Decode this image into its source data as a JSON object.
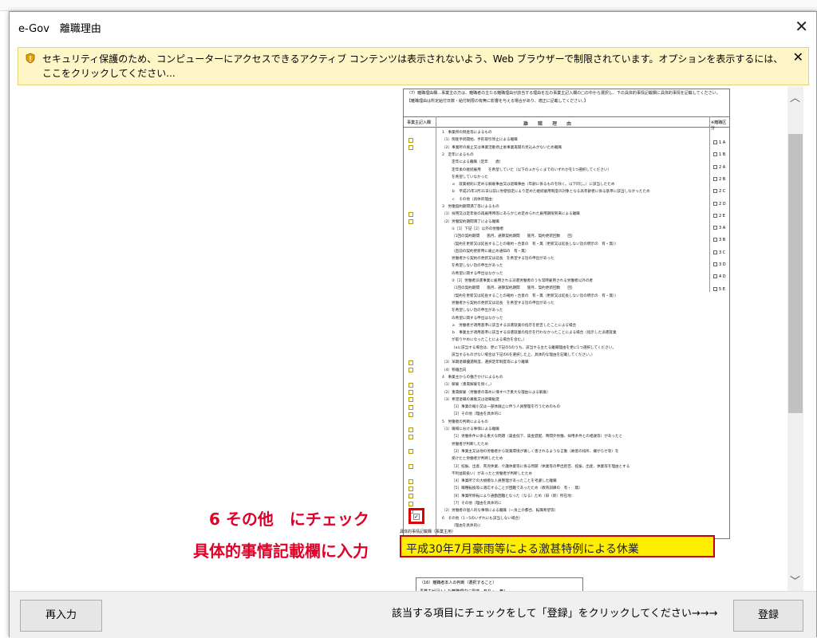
{
  "window": {
    "title": "e-Gov　離職理由",
    "close_glyph": "✕"
  },
  "infobar": {
    "message": "セキュリティ保護のため、コンピューターにアクセスできるアクティブ コンテンツは表示されないよう、Web ブラウザーで制限されています。オプションを表示するには、ここをクリックしてください...",
    "close_glyph": "✕"
  },
  "form": {
    "header_line1": "（7）離職理由欄…事業主の方は、離職者の主たる離職理由が該当する理由を左の事業主記入欄の□の中から選択し、下の具体的事情記載欄に具体的事情を記載してください。",
    "header_line2": "【離職理由は所定給付日数・給付制限の有無に影響を与える場合があり、適正に記載してください。】",
    "col_employer": "事業主記入欄",
    "col_reason": "離　　職　　理　　由",
    "col_code": "※離職区分",
    "codes": [
      "1 A",
      "1 B",
      "2 A",
      "2 B",
      "2 C",
      "2 D",
      "2 E",
      "3 A",
      "3 B",
      "3 C",
      "3 D",
      "4 D",
      "5 E"
    ],
    "rows": [
      "1　事業所の倒産等によるもの",
      "（1）倒産手続開始、手形取引停止による離職",
      "（2）事業所の廃止又は事業活動停止後事業再開の見込みがないため離職",
      "2　定年によるもの",
      "定年による離職（定年　　歳）",
      "定年後の継続雇用　　を希望していた（以下のａからｃまでのいずれかを1つ選択してください）",
      "を希望していなかった",
      "ａ　就業規則に定める解雇事由又は退職事由（年齢に係るものを除く。以下同じ。）に該当したため",
      "ｂ　平成25年3月31日以前に労使協定により定めた継続雇用制度の対象となる高年齢者に係る基準に該当しなかったため",
      "ｃ　その他（具体的理由：",
      "3　労働契約期間満了等によるもの",
      "（1）採用又は定年後の再雇用時等にあらかじめ定められた雇用期限到来による離職",
      "（2）労働契約期間満了による離職",
      "①［1］下記［2］以外の労働者",
      "（1回の契約期間　　箇月、通算契約期間　　箇月、契約更新回数　　回）",
      "（契約を更新又は延長することの確約・合意の　有・無（更新又は延長しない旨の明示の　有・無））",
      "（直前の契約更新時に雇止め通知の　有・無）",
      "労働者から契約の更新又は延長　を希望する旨の申出があった",
      "を希望しない旨の申出があった",
      "の希望に関する申出はなかった",
      "②［2］労働者派遣事業に雇用される派遣労働者のうち常時雇用される労働者以外の者",
      "（1回の契約期間　　箇月、通算契約期間　　箇月、契約更新回数　　回）",
      "（契約を更新又は延長することの確約・合意の　有・無（更新又は延長しない旨の明示の　有・無））",
      "労働者から契約の更新又は延長　を希望する旨の申出があった",
      "を希望しない旨の申出があった",
      "の希望に関する申出はなかった",
      "ａ　労働者が適用基準に該当する派遣就業の指示を拒否したことによる場合",
      "ｂ　事業主が適用基準に該当する派遣就業の指示を行わなかったことによる場合（指示した派遣就業",
      "が取りやめになったことによる場合を含む。）",
      "（aに該当する場合は、更に下記の5のうち、該当する主たる離職理由を更に1つ選択してください。",
      "該当するものがない場合は下記の6を選択した上、具体的な理由を記載してください。）",
      "（3）早期退職優遇制度、選択定年制度等により離職",
      "（4）移籍出向",
      "4　事業主からの働きかけによるもの",
      "（1）解雇（重責解雇を除く。）",
      "（2）重責解雇（労働者の責めに帰すべき重大な理由による解雇）",
      "（3）希望退職の募集又は退職勧奨",
      "［1］事業の縮小又は一部休廃止に伴う人員整理を行うためのもの",
      "［2］その他（理由を具体的に",
      "5　労働者の判断によるもの",
      "（1）職場における事情による離職",
      "［1］労働条件に係る重大な問題（賃金低下、賃金遅配、時間外労働、採用条件との相違等）があったと",
      "労働者が判断したため",
      "［2］事業主又は他の労働者から就業環境が著しく害されるような言動（故意の排斥、嫌がらせ等）を",
      "受けたと労働者が判断したため",
      "［3］妊娠、出産、育児休業、介護休業等に係る問題（休業等の申出拒否、妊娠、出産、休業等を理由とする",
      "不利益取扱い）があったと労働者が判断したため",
      "［4］事業所での大規模な人員整理があったことを考慮した離職",
      "［5］職種転換等に適応することが困難であったため（教育訓練の　有・　無）",
      "［6］事業所移転により通勤困難となった（なる）ため（旧（新）所在地：",
      "［7］その他（理由を具体的に",
      "（2）労働者の個人的な事情による離職（一身上の都合、転職希望等）",
      "6　その他（1－5のいずれにも該当しない場合）",
      "（理由を具体的に"
    ],
    "detail_label": "具体的事情記載欄（事業主用）",
    "detail_value": "平成30年7月豪雨等による激甚特例による休業",
    "sub_title": "（16）離職者本人の判断（選択すること）",
    "sub_row": "事業主が記入した離職理由に異議　有り・　無し"
  },
  "annotations": {
    "check_note": "6 その他　にチェック",
    "input_note": "具体的事情記載欄に入力"
  },
  "footer": {
    "reenter_label": "再入力",
    "hint": "該当する項目にチェックをして「登録」をクリックしてください→→→",
    "register_label": "登録"
  },
  "colors": {
    "highlight": "#ffee00",
    "annotation": "#e0002a",
    "infobar": "#fff6c7"
  }
}
